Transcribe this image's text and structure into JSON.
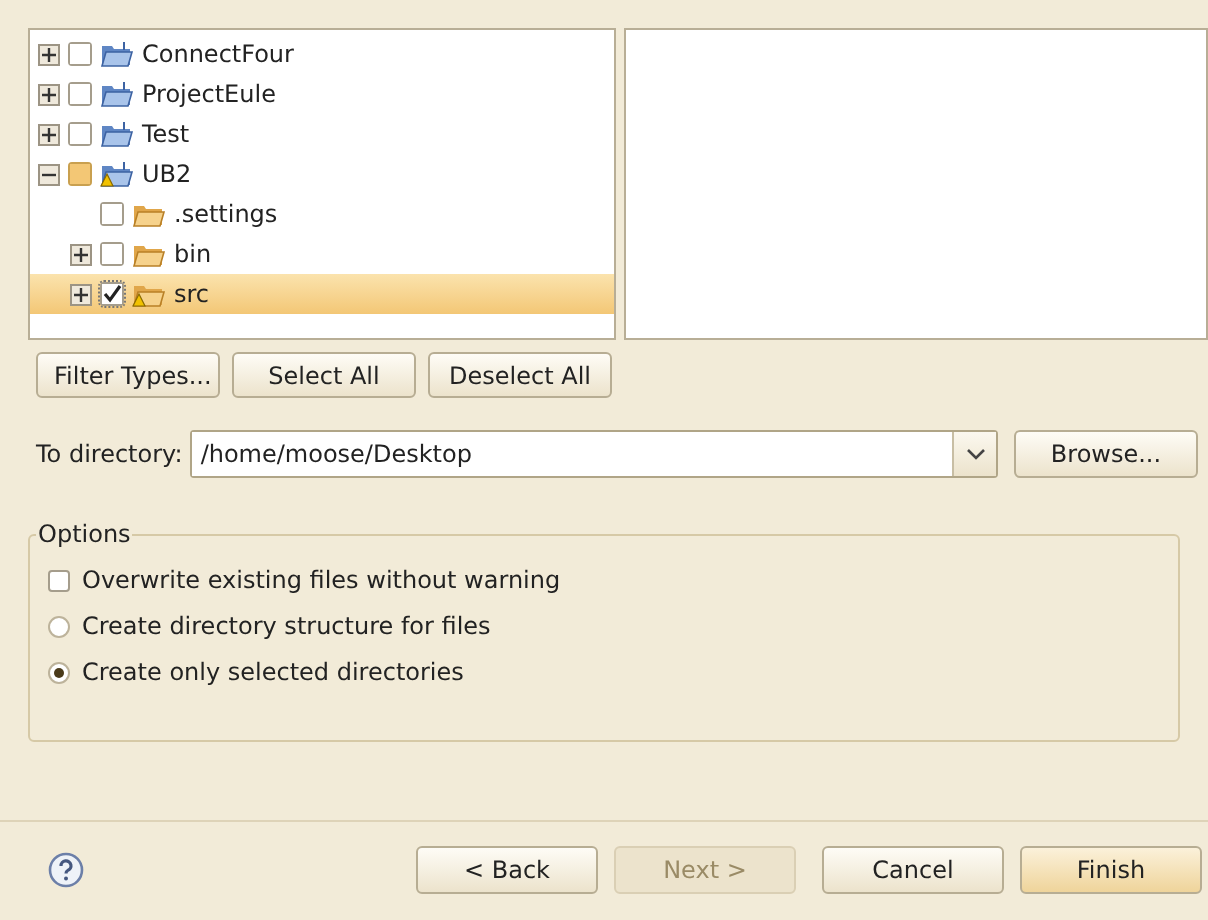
{
  "tree": [
    {
      "label": "ConnectFour",
      "kind": "project",
      "expandable": true,
      "expanded": false,
      "checked": false,
      "partial": false,
      "warning": false,
      "selected": false
    },
    {
      "label": "ProjectEule",
      "kind": "project",
      "expandable": true,
      "expanded": false,
      "checked": false,
      "partial": false,
      "warning": false,
      "selected": false
    },
    {
      "label": "Test",
      "kind": "project",
      "expandable": true,
      "expanded": false,
      "checked": false,
      "partial": false,
      "warning": false,
      "selected": false
    },
    {
      "label": "UB2",
      "kind": "project",
      "expandable": true,
      "expanded": true,
      "checked": false,
      "partial": true,
      "warning": true,
      "selected": false,
      "children": [
        {
          "label": ".settings",
          "kind": "folder",
          "expandable": false,
          "checked": false,
          "partial": false,
          "warning": false,
          "selected": false
        },
        {
          "label": "bin",
          "kind": "folder",
          "expandable": true,
          "expanded": false,
          "checked": false,
          "partial": false,
          "warning": false,
          "selected": false
        },
        {
          "label": "src",
          "kind": "folder",
          "expandable": true,
          "expanded": false,
          "checked": true,
          "partial": false,
          "warning": true,
          "selected": true
        }
      ]
    }
  ],
  "selection_buttons": [
    {
      "label": "Filter Types..."
    },
    {
      "label": "Select All"
    },
    {
      "label": "Deselect All"
    }
  ],
  "directory": {
    "label": "To directory:",
    "value": "/home/moose/Desktop",
    "browse": {
      "label": "Browse..."
    }
  },
  "options": {
    "title": "Options",
    "items": [
      {
        "kind": "checkbox",
        "label": "Overwrite existing files without warning",
        "checked": false
      },
      {
        "kind": "radio",
        "label": "Create directory structure for files",
        "checked": false
      },
      {
        "kind": "radio",
        "label": "Create only selected directories",
        "checked": true
      }
    ]
  },
  "footer_buttons": [
    {
      "label": "< Back",
      "disabled": false,
      "default": false
    },
    {
      "label": "Next >",
      "disabled": true,
      "default": false
    },
    {
      "label": "Cancel",
      "disabled": false,
      "default": false
    },
    {
      "label": "Finish",
      "disabled": false,
      "default": true
    }
  ]
}
